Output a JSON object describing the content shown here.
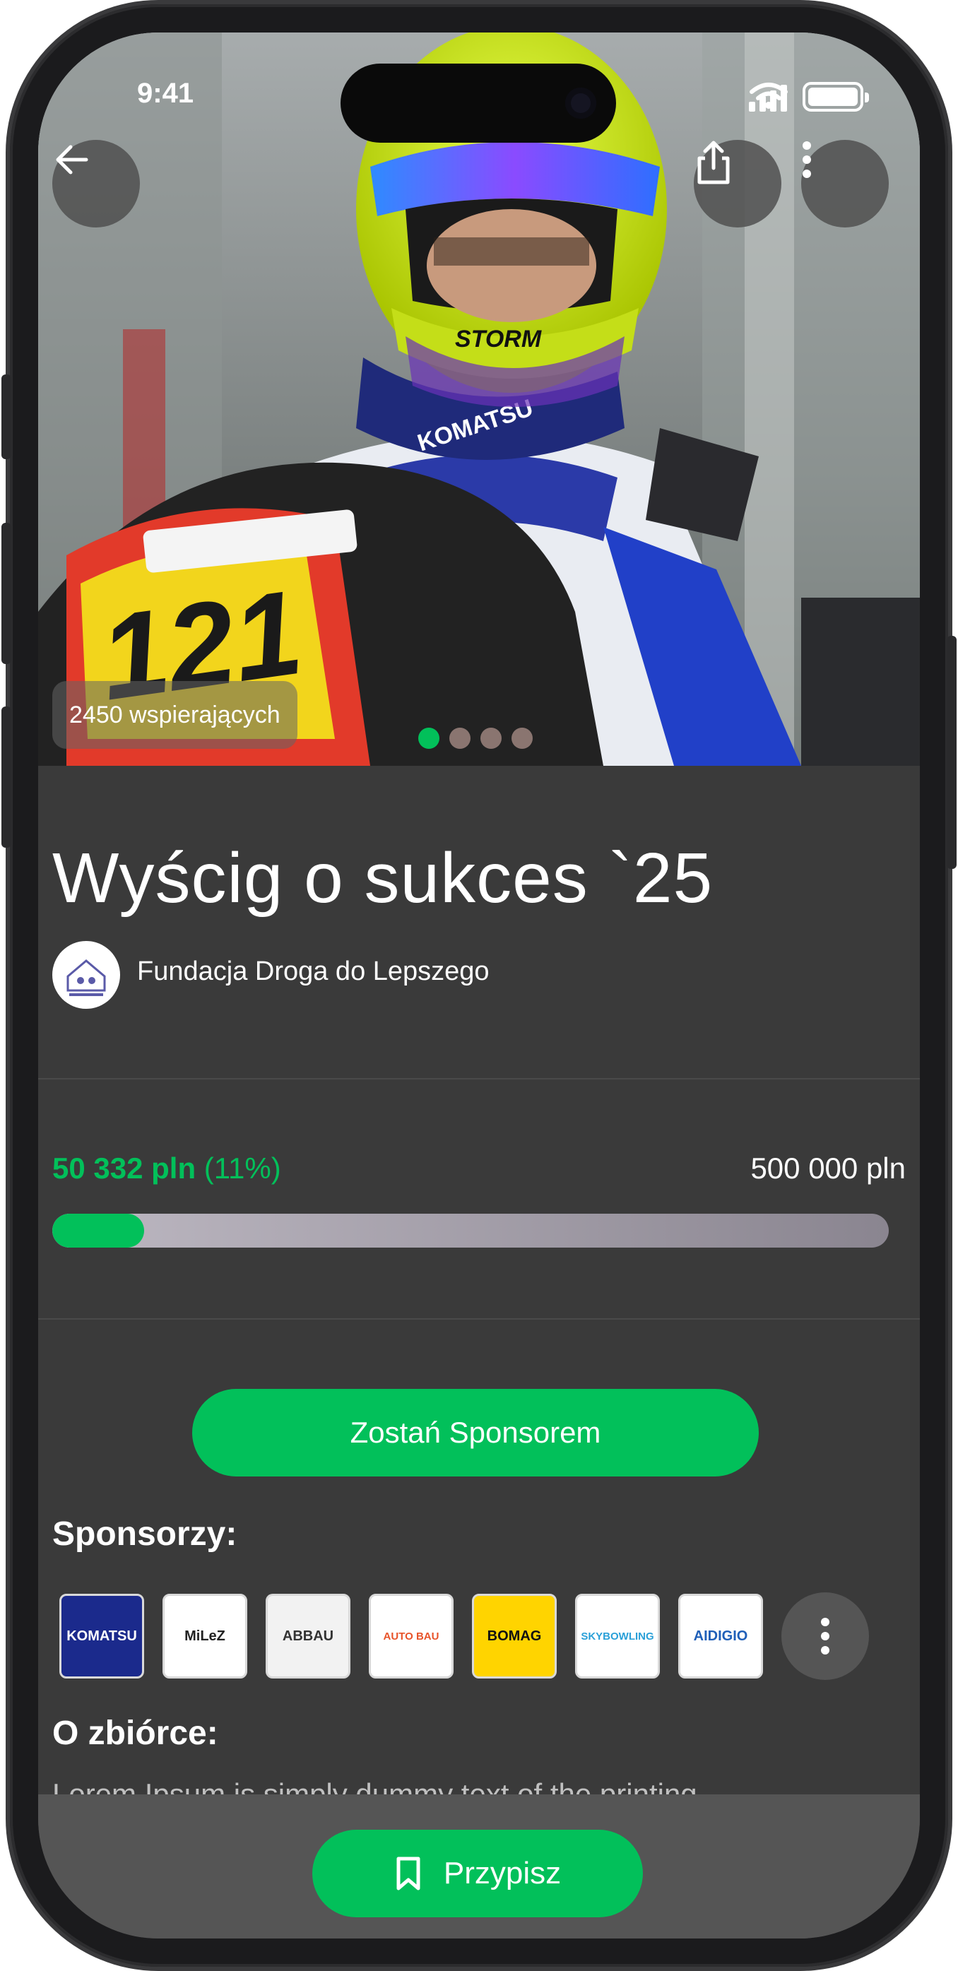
{
  "status_bar": {
    "time": "9:41"
  },
  "hero": {
    "supporters_label": "2450 wspierających",
    "carousel": {
      "count": 4,
      "active_index": 0
    }
  },
  "campaign": {
    "title": "Wyścig o sukces `25",
    "organization": "Fundacja Droga do Lepszego"
  },
  "funding": {
    "raised": "50 332 pln",
    "percent_label": "(11%)",
    "goal": "500 000 pln",
    "progress_fraction": 0.11
  },
  "actions": {
    "sponsor_button": "Zostań Sponsorem",
    "assign_button": "Przypisz"
  },
  "sponsors": {
    "heading": "Sponsorzy:",
    "logos": [
      {
        "name": "KOMATSU",
        "bg": "#1b2a8c",
        "fg": "#ffffff"
      },
      {
        "name": "MiLeZ",
        "bg": "#ffffff",
        "fg": "#222222"
      },
      {
        "name": "ABBAU",
        "bg": "#f2f2f2",
        "fg": "#333333"
      },
      {
        "name": "AUTO BAU",
        "bg": "#ffffff",
        "fg": "#e8542a"
      },
      {
        "name": "BOMAG",
        "bg": "#ffd400",
        "fg": "#111111"
      },
      {
        "name": "SKYBOWLING",
        "bg": "#ffffff",
        "fg": "#2aa0d8"
      },
      {
        "name": "AIDIGIO",
        "bg": "#ffffff",
        "fg": "#1f5fb8"
      }
    ]
  },
  "about": {
    "heading": "O zbiórce:",
    "preview": "Lorem Ipsum is simply dummy text of the printing"
  },
  "colors": {
    "accent": "#02c05a",
    "background": "#3a3a3a",
    "bottom_bar": "#555555"
  }
}
